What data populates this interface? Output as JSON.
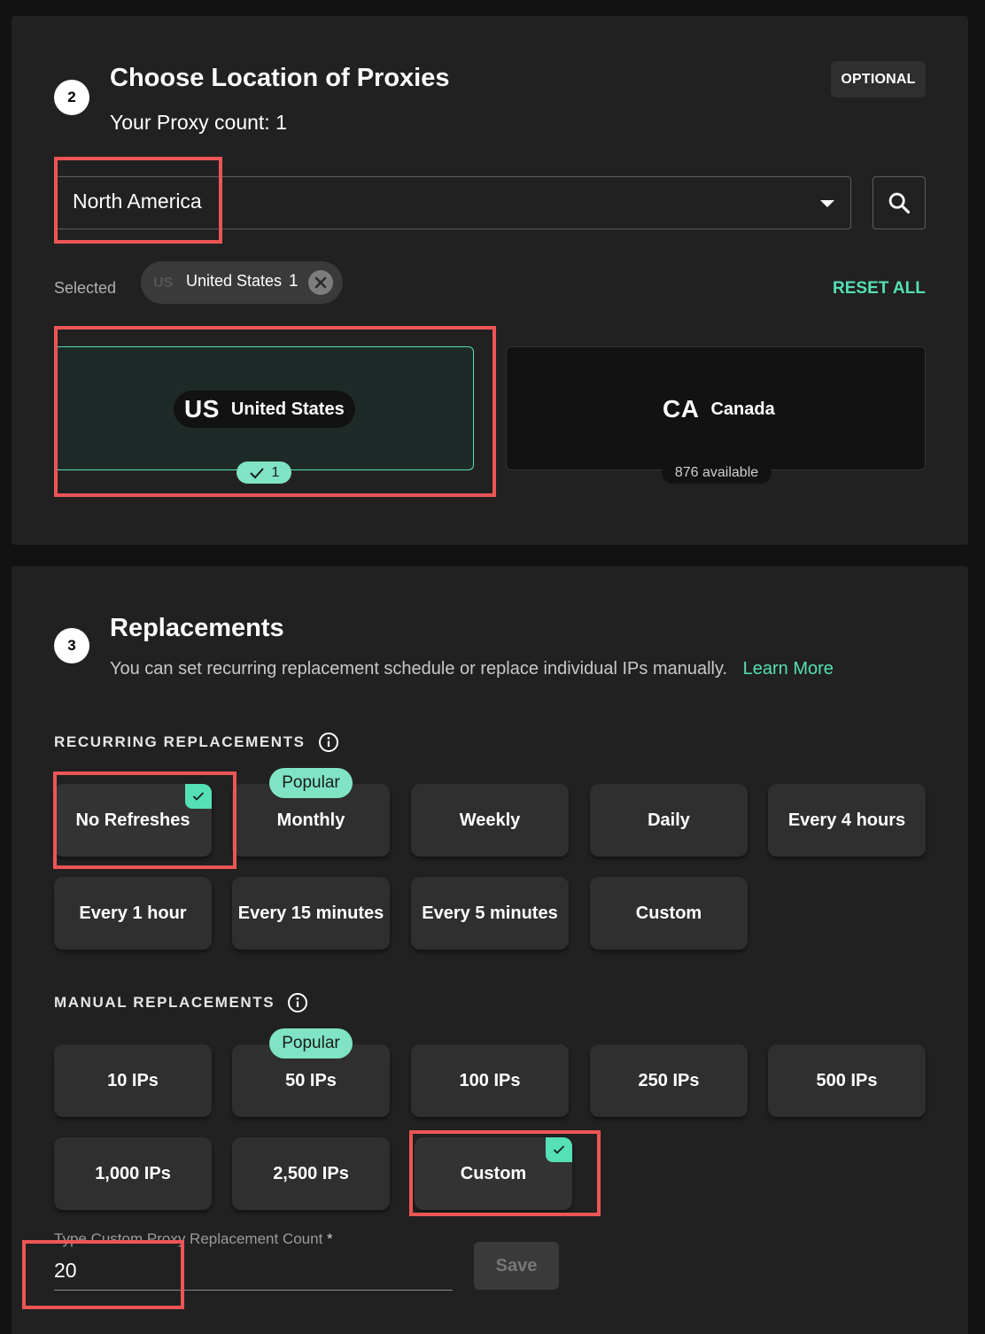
{
  "location": {
    "step_number": "2",
    "title": "Choose Location of Proxies",
    "optional_label": "OPTIONAL",
    "proxy_count_text": "Your Proxy count: 1",
    "region_value": "North America",
    "selected_label": "Selected",
    "selected_chip": {
      "flag": "US",
      "label": "United States",
      "count": "1"
    },
    "reset_all_label": "RESET ALL",
    "countries": [
      {
        "code": "US",
        "name": "United States",
        "badge": "1",
        "selected": true
      },
      {
        "code": "CA",
        "name": "Canada",
        "badge": "876 available",
        "selected": false
      }
    ]
  },
  "replacements": {
    "step_number": "3",
    "title": "Replacements",
    "subtitle": "You can set recurring replacement schedule or replace individual IPs manually.",
    "learn_more": "Learn More",
    "recurring": {
      "label": "RECURRING REPLACEMENTS",
      "popular_tag": "Popular",
      "options": [
        "No Refreshes",
        "Monthly",
        "Weekly",
        "Daily",
        "Every 4 hours",
        "Every 1 hour",
        "Every 15 minutes",
        "Every 5 minutes",
        "Custom"
      ],
      "selected": "No Refreshes",
      "popular": "Monthly"
    },
    "manual": {
      "label": "MANUAL REPLACEMENTS",
      "popular_tag": "Popular",
      "options": [
        "10 IPs",
        "50 IPs",
        "100 IPs",
        "250 IPs",
        "500 IPs",
        "1,000 IPs",
        "2,500 IPs",
        "Custom"
      ],
      "selected": "Custom",
      "popular": "50 IPs"
    },
    "custom_field": {
      "label": "Type Custom Proxy Replacement Count",
      "required_mark": "*",
      "value": "20"
    },
    "save_label": "Save"
  },
  "colors": {
    "accent": "#55e0b5",
    "popular_bg": "#7fe3c4",
    "card_bg": "#212121",
    "page_bg": "#121212",
    "highlight": "#ee5555"
  }
}
